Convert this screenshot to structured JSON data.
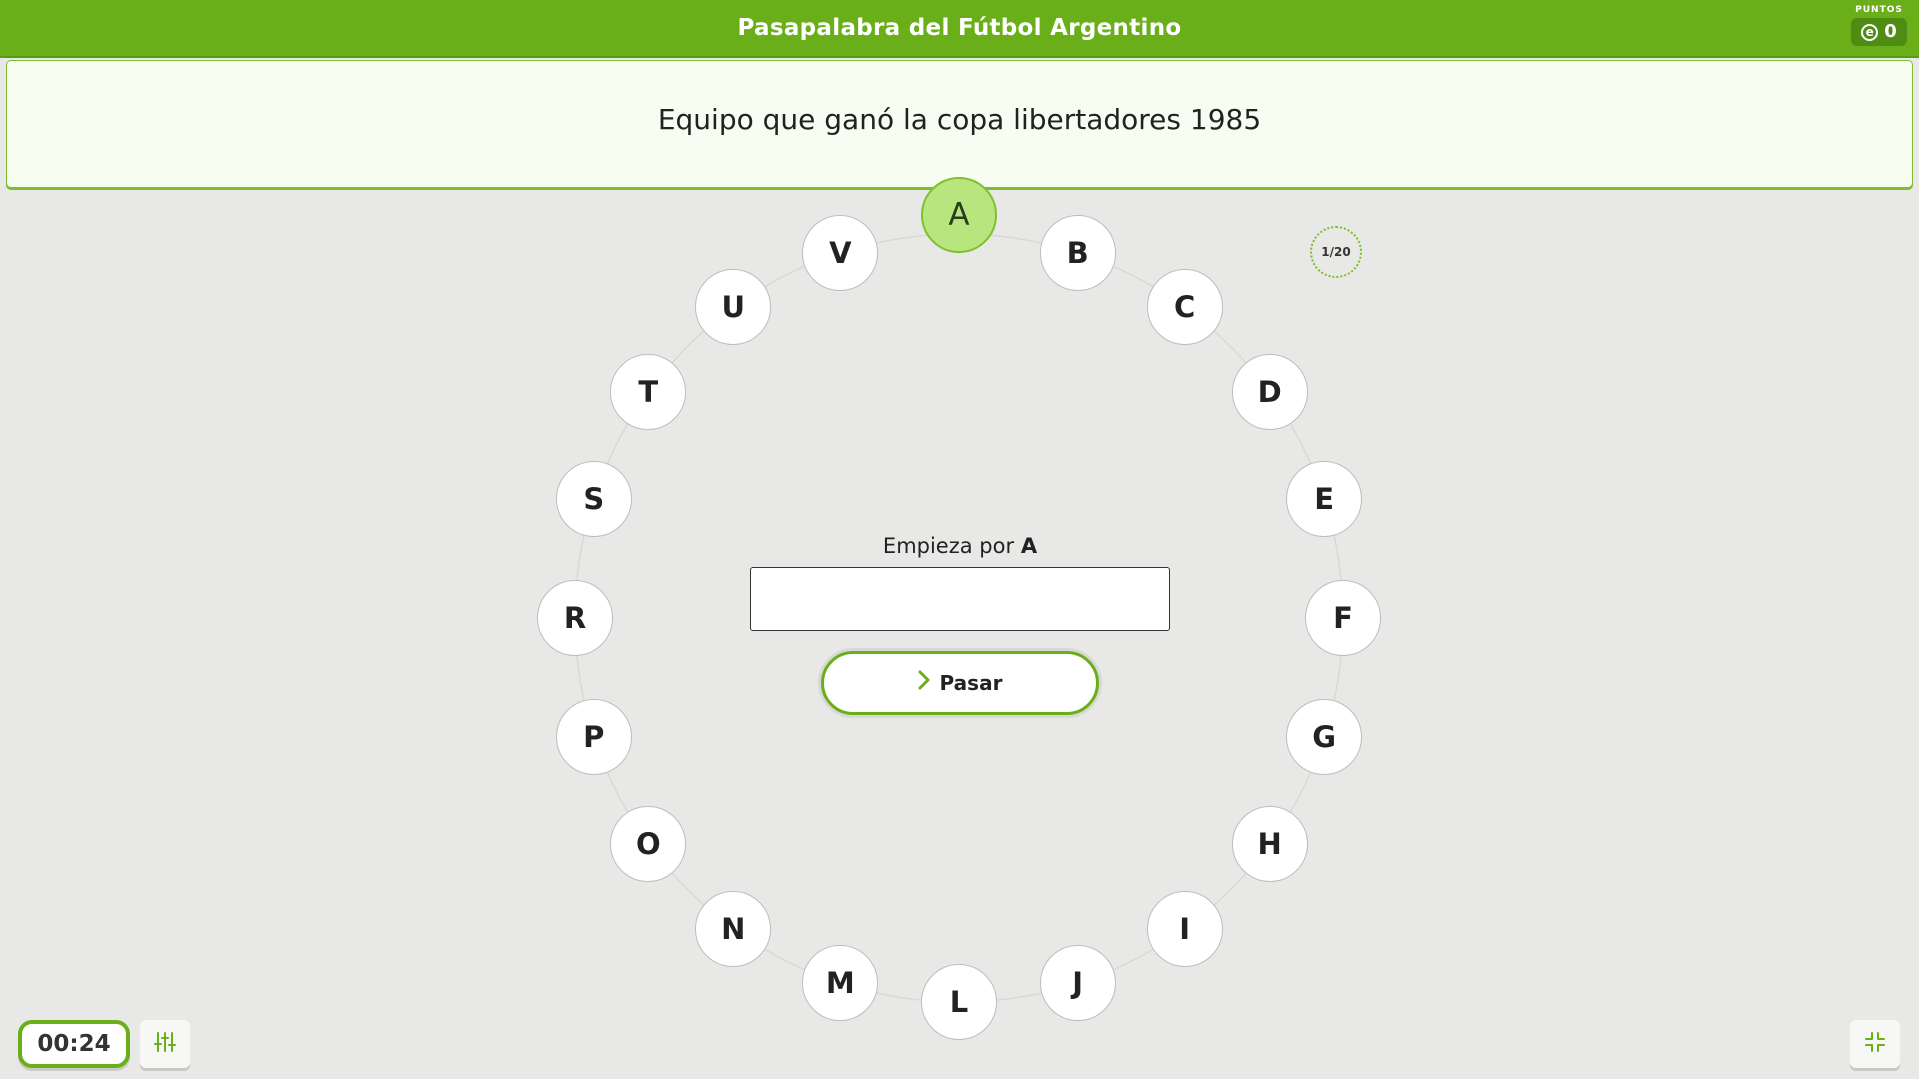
{
  "header": {
    "title": "Pasapalabra del Fútbol Argentino"
  },
  "points": {
    "label": "PUNTOS",
    "coin_symbol": "e",
    "value": "0"
  },
  "question": {
    "text": "Equipo que ganó la copa libertadores 1985"
  },
  "letters": [
    "A",
    "B",
    "C",
    "D",
    "E",
    "F",
    "G",
    "H",
    "I",
    "J",
    "L",
    "M",
    "N",
    "O",
    "P",
    "R",
    "S",
    "T",
    "U",
    "V"
  ],
  "active_letter": "A",
  "progress": {
    "label": "1/20",
    "current": 1,
    "total": 20
  },
  "hint": {
    "prefix": "Empieza por",
    "letter": "A"
  },
  "answer_input": {
    "value": "",
    "placeholder": ""
  },
  "pass_button": {
    "label": "Pasar"
  },
  "timer": {
    "value": "00:24"
  },
  "colors": {
    "accent": "#6aaf1a",
    "active_letter_bg": "#b8e57d",
    "background": "#e8e8e6"
  },
  "icons": {
    "settings": "sliders-icon",
    "fullscreen": "exit-fullscreen-icon",
    "pass": "chevron-right-icon"
  }
}
